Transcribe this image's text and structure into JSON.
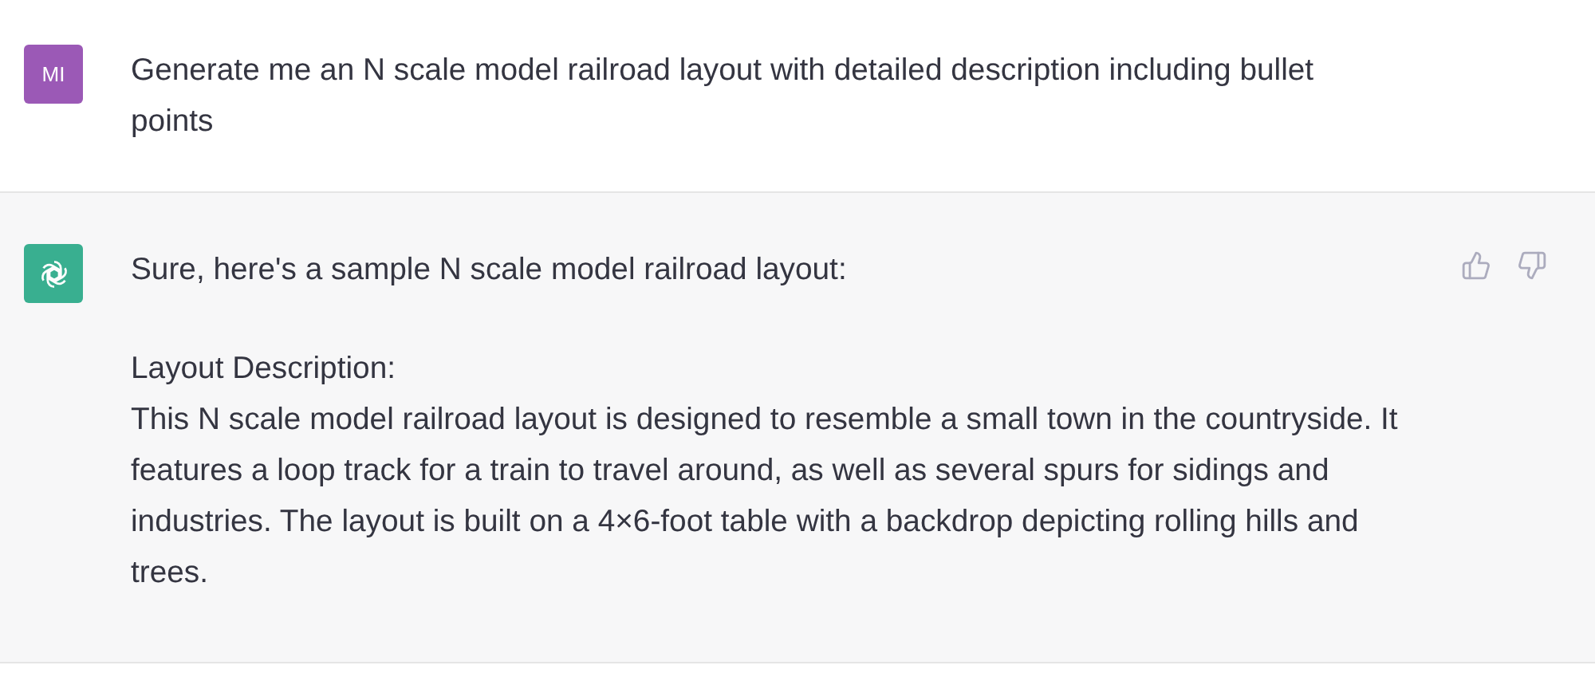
{
  "messages": [
    {
      "kind": "user",
      "avatar": "MI",
      "paragraphs": [
        "Generate me an N scale model railroad layout with detailed description including bullet points"
      ]
    },
    {
      "kind": "assistant",
      "paragraphs": [
        "Sure, here's a sample N scale model railroad layout:",
        "Layout Description:",
        "This N scale model railroad layout is designed to resemble a small town in the countryside. It features a loop track for a train to travel around, as well as several spurs for sidings and industries. The layout is built on a 4×6-foot table with a backdrop depicting rolling hills and trees."
      ]
    }
  ]
}
